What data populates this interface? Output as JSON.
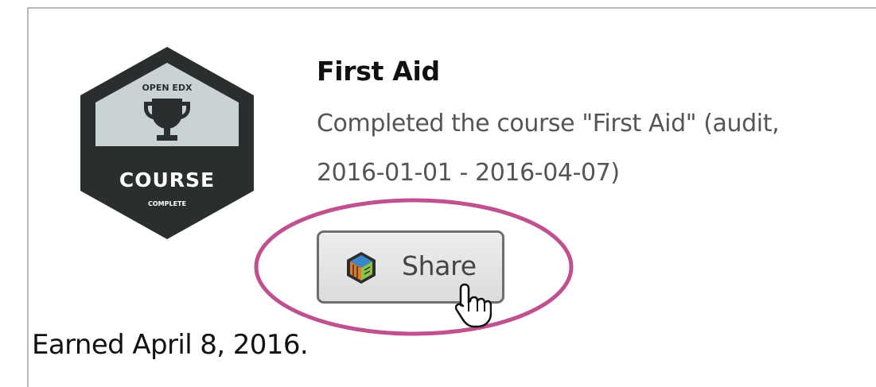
{
  "badge": {
    "top_text": "OPEN EDX",
    "main_text": "COURSE",
    "sub_text": "COMPLETE",
    "colors": {
      "hexagon_dark": "#2a2e2f",
      "panel_light": "#c9d3d5",
      "icon_dark": "#2a2e2f",
      "text_light": "#ffffff"
    },
    "icon": "trophy-icon"
  },
  "course": {
    "title": "First Aid",
    "description_line1": "Completed the course \"First Aid\" (audit,",
    "description_line2": "2016-01-01 - 2016-04-07)"
  },
  "share": {
    "label": "Share",
    "icon": "share-logo-icon"
  },
  "highlight": {
    "color": "#c0518f"
  },
  "earned_text": "Earned April 8, 2016."
}
